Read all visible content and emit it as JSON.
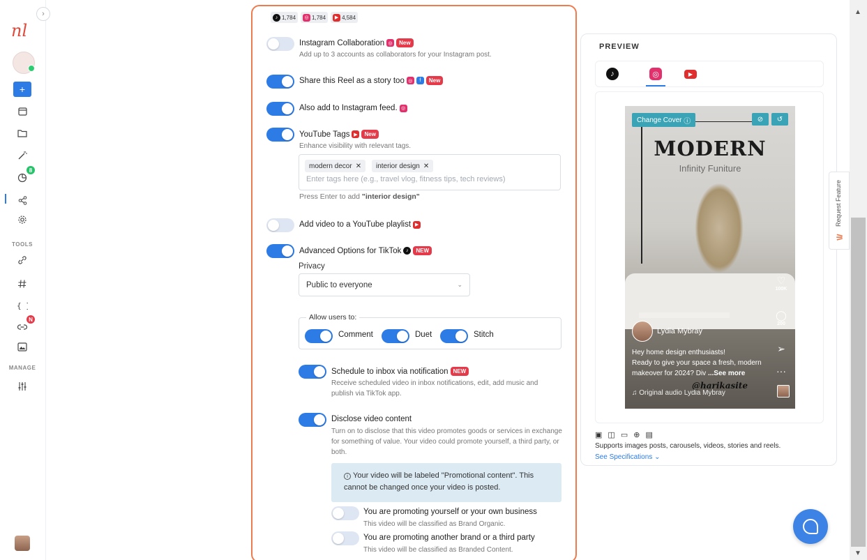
{
  "sidebar": {
    "toggle": "›",
    "logo": "nl",
    "plus": "+",
    "analytics_badge": "8",
    "links_badge": "N",
    "tools_label": "TOOLS",
    "manage_label": "MANAGE"
  },
  "stats": [
    {
      "platform": "tiktok",
      "value": "1,784"
    },
    {
      "platform": "instagram",
      "value": "1,784"
    },
    {
      "platform": "youtube",
      "value": "4,584"
    }
  ],
  "options": {
    "ig_collab": {
      "title": "Instagram Collaboration",
      "sub": "Add up to 3 accounts as collaborators for your Instagram post.",
      "new": "New",
      "on": false
    },
    "story": {
      "title": "Share this Reel as a story too",
      "new": "New",
      "on": true
    },
    "feed": {
      "title": "Also add to Instagram feed.",
      "on": true
    },
    "yt_tags": {
      "title": "YouTube Tags",
      "new": "New",
      "sub": "Enhance visibility with relevant tags.",
      "on": true
    },
    "playlist": {
      "title": "Add video to a YouTube playlist",
      "on": false
    },
    "tiktok_adv": {
      "title": "Advanced Options for TikTok",
      "new": "NEW",
      "on": true
    }
  },
  "tags": {
    "chips": [
      "modern decor",
      "interior design"
    ],
    "placeholder": "Enter tags here (e.g., travel vlog, fitness tips, tech reviews)",
    "hint_prefix": "Press Enter to add",
    "hint_value": "\"interior design\""
  },
  "privacy": {
    "label": "Privacy",
    "value": "Public to everyone"
  },
  "allow": {
    "legend": "Allow users to:",
    "comment": "Comment",
    "duet": "Duet",
    "stitch": "Stitch"
  },
  "inbox": {
    "title": "Schedule to inbox via notification",
    "new": "NEW",
    "sub": "Receive scheduled video in inbox notifications, edit, add music and publish via TikTok app."
  },
  "disclose": {
    "title": "Disclose video content",
    "sub": "Turn on to disclose that this video promotes goods or services in exchange for something of value. Your video could promote yourself, a third party, or both."
  },
  "info": "Your video will be labeled \"Promotional content\". This cannot be changed once your video is posted.",
  "promo_self": {
    "title": "You are promoting yourself or your own business",
    "sub": "This video will be classified as Brand Organic."
  },
  "promo_other": {
    "title": "You are promoting another brand or a third party",
    "sub": "This video will be classified as Branded Content."
  },
  "preview": {
    "heading": "PREVIEW",
    "change_cover": "Change Cover",
    "title": "MODERN",
    "subtitle": "Infinity Funiture",
    "username": "Lydia Mybray",
    "caption_1": "Hey home design enthusiasts!",
    "caption_2": "Ready to give your space a fresh, modern makeover for 2024?",
    "caption_3": "Div",
    "see_more": "...See more",
    "watermark": "@harikasite",
    "audio": "Original audio Lydia Mybray",
    "likes": "100K",
    "comments": "200",
    "supports": "Supports images posts, carousels, videos, stories and reels.",
    "see_specs": "See Specifications"
  },
  "request_feature": "Request Feature",
  "colors": {
    "accent": "#2d7be5",
    "frame": "#ee7b4f",
    "new_tag": "#e53a4a",
    "info_bg": "#dbeaf3"
  }
}
